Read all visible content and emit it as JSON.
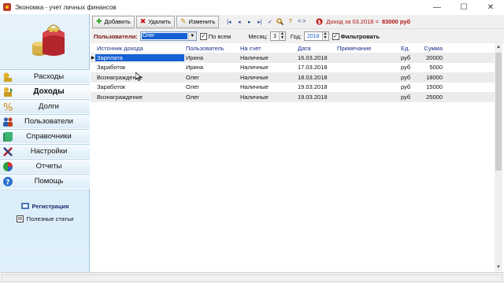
{
  "window": {
    "title": "Экономка - учет личных финансов",
    "minimize": "—",
    "maximize": "☐",
    "close": "✕"
  },
  "nav": {
    "items": [
      {
        "label": "Расходы",
        "icon": "expenses-icon"
      },
      {
        "label": "Доходы",
        "icon": "income-icon",
        "active": true
      },
      {
        "label": "Долги",
        "icon": "debts-icon"
      },
      {
        "label": "Пользователи",
        "icon": "users-icon"
      },
      {
        "label": "Справочники",
        "icon": "directories-icon"
      },
      {
        "label": "Настройки",
        "icon": "settings-icon"
      },
      {
        "label": "Отчеты",
        "icon": "reports-icon"
      },
      {
        "label": "Помощь",
        "icon": "help-icon"
      }
    ],
    "registration": "Регистрация",
    "useful_articles": "Полезные статьи"
  },
  "toolbar": {
    "add_label": "Добавить",
    "delete_label": "Удалить",
    "edit_label": "Изменить",
    "nav_first": "|◂",
    "nav_prev": "◂",
    "nav_next": "▸",
    "nav_last": "▸|",
    "check": "✓",
    "search": "🔍",
    "help": "?",
    "code": "<·>",
    "income_label": "Доход за 03.2018 =",
    "income_amount": "83000 руб"
  },
  "filter": {
    "users_label": "Пользователи:",
    "users_value": "Олег",
    "all_label": "По всем",
    "month_label": "Месяц:",
    "month_value": "3",
    "year_label": "Год:",
    "year_value": "2018",
    "filter_label": "Фильтровать",
    "all_checked": true,
    "filter_checked": true
  },
  "table": {
    "columns": [
      "Источник дохода",
      "Пользователь",
      "На счет",
      "Дата",
      "Примечание",
      "Ед.",
      "Сумма"
    ],
    "rows": [
      {
        "source": "Зарплата",
        "user": "Ирина",
        "account": "Наличные",
        "date": "16.03.2018",
        "note": "",
        "unit": "руб",
        "sum": "20000",
        "selected": true
      },
      {
        "source": "Заработок",
        "user": "Ирина",
        "account": "Наличные",
        "date": "17.03.2018",
        "note": "",
        "unit": "руб",
        "sum": "5000"
      },
      {
        "source": "Вознаграждение",
        "user": "Олег",
        "account": "Наличные",
        "date": "18.03.2018",
        "note": "",
        "unit": "руб",
        "sum": "18000"
      },
      {
        "source": "Заработок",
        "user": "Олег",
        "account": "Наличные",
        "date": "19.03.2018",
        "note": "",
        "unit": "руб",
        "sum": "15000"
      },
      {
        "source": "Вознаграждение",
        "user": "Олег",
        "account": "Наличные",
        "date": "19.03.2018",
        "note": "",
        "unit": "руб",
        "sum": "25000"
      }
    ]
  },
  "colors": {
    "accent": "#1560d4",
    "income_text": "#b01010",
    "header_text": "#1b2f8c"
  }
}
